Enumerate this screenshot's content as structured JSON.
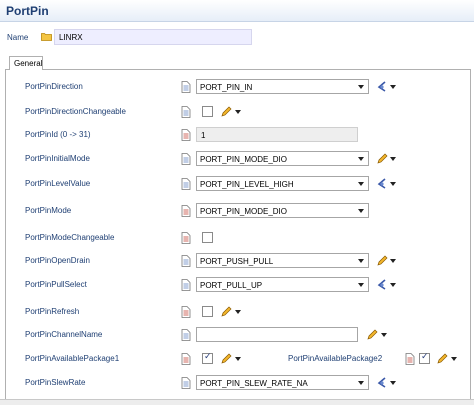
{
  "window": {
    "title": "PortPin"
  },
  "name_field": {
    "label": "Name",
    "value": "LINRX"
  },
  "tab": {
    "label": "General"
  },
  "params": {
    "direction": {
      "label": "PortPinDirection",
      "value": "PORT_PIN_IN"
    },
    "direction_changeable": {
      "label": "PortPinDirectionChangeable",
      "checked": false
    },
    "id": {
      "label": "PortPinId (0 -> 31)",
      "value": "1"
    },
    "initial_mode": {
      "label": "PortPinInitialMode",
      "value": "PORT_PIN_MODE_DIO"
    },
    "level_value": {
      "label": "PortPinLevelValue",
      "value": "PORT_PIN_LEVEL_HIGH"
    },
    "mode": {
      "label": "PortPinMode",
      "value": "PORT_PIN_MODE_DIO"
    },
    "mode_changeable": {
      "label": "PortPinModeChangeable",
      "checked": false
    },
    "open_drain": {
      "label": "PortPinOpenDrain",
      "value": "PORT_PUSH_PULL"
    },
    "pull_select": {
      "label": "PortPinPullSelect",
      "value": "PORT_PULL_UP"
    },
    "refresh": {
      "label": "PortPinRefresh",
      "checked": false
    },
    "channel_name": {
      "label": "PortPinChannelName",
      "value": ""
    },
    "available_package1": {
      "label": "PortPinAvailablePackage1",
      "checked": true
    },
    "available_package2": {
      "label": "PortPinAvailablePackage2",
      "checked": true
    },
    "slew_rate": {
      "label": "PortPinSlewRate",
      "value": "PORT_PIN_SLEW_RATE_NA"
    }
  },
  "icons": {
    "folder": "folder-icon",
    "document": "document-icon",
    "pencil": "pencil-icon",
    "reset": "reset-default-icon"
  },
  "colors": {
    "label_blue": "#1f3f73",
    "name_field_bg": "#eeeeff"
  }
}
